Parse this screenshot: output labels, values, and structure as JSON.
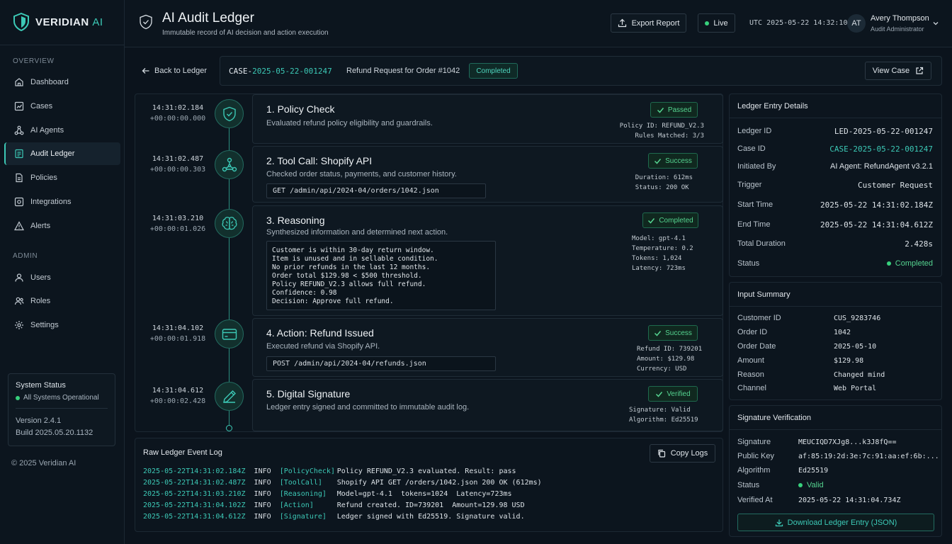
{
  "brand": {
    "name": "VERIDIAN",
    "suffix": "AI"
  },
  "sidebar": {
    "sections": [
      "OVERVIEW",
      "ADMIN"
    ],
    "items": [
      {
        "label": "Dashboard",
        "icon": "home-icon"
      },
      {
        "label": "Cases",
        "icon": "chart-icon"
      },
      {
        "label": "AI Agents",
        "icon": "network-icon"
      },
      {
        "label": "Audit Ledger",
        "icon": "ledger-icon",
        "active": true
      },
      {
        "label": "Policies",
        "icon": "document-icon"
      },
      {
        "label": "Integrations",
        "icon": "integration-icon"
      },
      {
        "label": "Alerts",
        "icon": "alert-icon"
      },
      {
        "label": "Users",
        "icon": "user-icon"
      },
      {
        "label": "Roles",
        "icon": "roles-icon"
      },
      {
        "label": "Settings",
        "icon": "gear-icon"
      }
    ],
    "system": {
      "title": "System Status",
      "status": "All Systems Operational",
      "version": "Version 2.4.1",
      "build": "Build 2025.05.20.1132"
    },
    "copyright": "© 2025 Veridian AI"
  },
  "header": {
    "title": "AI Audit Ledger",
    "subtitle": "Immutable record of AI decision and action execution",
    "export_label": "Export Report",
    "live_label": "Live",
    "utc": "UTC 2025-05-22 14:32:10Z",
    "user": {
      "initials": "AT",
      "name": "Avery Thompson",
      "role": "Audit Administrator"
    }
  },
  "case": {
    "back_label": "Back to Ledger",
    "prefix": "CASE-",
    "id_rest": "2025-05-22-001247",
    "request": "Refund Request for Order #1042",
    "status": "Completed",
    "view_label": "View Case"
  },
  "steps": [
    {
      "time": "14:31:02.184",
      "offset": "+00:00:00.000",
      "title": "1. Policy Check",
      "desc": "Evaluated refund policy eligibility and guardrails.",
      "badge": "Passed",
      "meta": [
        "Policy ID: REFUND_V2.3",
        "Rules Matched: 3/3"
      ],
      "icon": "shield-check-icon"
    },
    {
      "time": "14:31:02.487",
      "offset": "+00:00:00.303",
      "title": "2. Tool Call: Shopify API",
      "desc": "Checked order status, payments, and customer history.",
      "code": "GET /admin/api/2024-04/orders/1042.json",
      "badge": "Success",
      "meta": [
        "Duration: 612ms",
        "Status: 200 OK"
      ],
      "icon": "network-icon"
    },
    {
      "time": "14:31:03.210",
      "offset": "+00:00:01.026",
      "title": "3. Reasoning",
      "desc": "Synthesized information and determined next action.",
      "reasoning": "Customer is within 30-day return window.\nItem is unused and in sellable condition.\nNo prior refunds in the last 12 months.\nOrder total $129.98 < $500 threshold.\nPolicy REFUND_V2.3 allows full refund.\nConfidence: 0.98\nDecision: Approve full refund.",
      "badge": "Completed",
      "meta": [
        "Model: gpt-4.1",
        "Temperature: 0.2",
        "Tokens: 1,024",
        "Latency: 723ms"
      ],
      "icon": "brain-icon"
    },
    {
      "time": "14:31:04.102",
      "offset": "+00:00:01.918",
      "title": "4. Action: Refund Issued",
      "desc": "Executed refund via Shopify API.",
      "code": "POST /admin/api/2024-04/refunds.json",
      "badge": "Success",
      "meta": [
        "Refund ID: 739201",
        "Amount: $129.98",
        "Currency: USD"
      ],
      "icon": "credit-card-icon"
    },
    {
      "time": "14:31:04.612",
      "offset": "+00:00:02.428",
      "title": "5. Digital Signature",
      "desc": "Ledger entry signed and committed to immutable audit log.",
      "badge": "Verified",
      "meta": [
        "Signature: Valid",
        "Algorithm: Ed25519"
      ],
      "icon": "pen-icon"
    }
  ],
  "log": {
    "title": "Raw Ledger Event Log",
    "copy_label": "Copy Logs",
    "rows": [
      {
        "ts": "2025-05-22T14:31:02.184Z",
        "level": "INFO",
        "src": "[PolicyCheck]",
        "msg": "Policy REFUND_V2.3 evaluated. Result: pass"
      },
      {
        "ts": "2025-05-22T14:31:02.487Z",
        "level": "INFO",
        "src": "[ToolCall]",
        "msg": "Shopify API GET /orders/1042.json 200 OK (612ms)"
      },
      {
        "ts": "2025-05-22T14:31:03.210Z",
        "level": "INFO",
        "src": "[Reasoning]",
        "msg": "Model=gpt-4.1  tokens=1024  Latency=723ms"
      },
      {
        "ts": "2025-05-22T14:31:04.102Z",
        "level": "INFO",
        "src": "[Action]",
        "msg": "Refund created. ID=739201  Amount=129.98 USD"
      },
      {
        "ts": "2025-05-22T14:31:04.612Z",
        "level": "INFO",
        "src": "[Signature]",
        "msg": "Ledger signed with Ed25519. Signature valid."
      }
    ]
  },
  "details": {
    "title": "Ledger Entry Details",
    "rows": [
      {
        "k": "Ledger ID",
        "v": "LED-2025-05-22-001247"
      },
      {
        "k": "Case ID",
        "v": "CASE-2025-05-22-001247"
      },
      {
        "k": "Initiated By",
        "v": "AI Agent: RefundAgent v3.2.1"
      },
      {
        "k": "Trigger",
        "v": "Customer Request"
      },
      {
        "k": "Start Time",
        "v": "2025-05-22 14:31:02.184Z"
      },
      {
        "k": "End Time",
        "v": "2025-05-22 14:31:04.612Z"
      },
      {
        "k": "Total Duration",
        "v": "2.428s"
      },
      {
        "k": "Status",
        "v": "Completed"
      }
    ]
  },
  "input": {
    "title": "Input Summary",
    "rows": [
      {
        "k": "Customer ID",
        "v": "CUS_9283746"
      },
      {
        "k": "Order ID",
        "v": "1042"
      },
      {
        "k": "Order Date",
        "v": "2025-05-10"
      },
      {
        "k": "Amount",
        "v": "$129.98"
      },
      {
        "k": "Reason",
        "v": "Changed mind"
      },
      {
        "k": "Channel",
        "v": "Web Portal"
      }
    ]
  },
  "signature": {
    "title": "Signature Verification",
    "rows": [
      {
        "k": "Signature",
        "v": "MEUCIQD7XJg8...k3J8fQ=="
      },
      {
        "k": "Public Key",
        "v": "af:85:19:2d:3e:7c:91:aa:ef:6b:..."
      },
      {
        "k": "Algorithm",
        "v": "Ed25519"
      },
      {
        "k": "Status",
        "v": "Valid"
      },
      {
        "k": "Verified At",
        "v": "2025-05-22 14:31:04.734Z"
      }
    ],
    "download_label": "Download Ledger Entry (JSON)"
  },
  "colors": {
    "accent": "#3cc9b6",
    "success": "#55d490",
    "background": "#0b131c"
  }
}
